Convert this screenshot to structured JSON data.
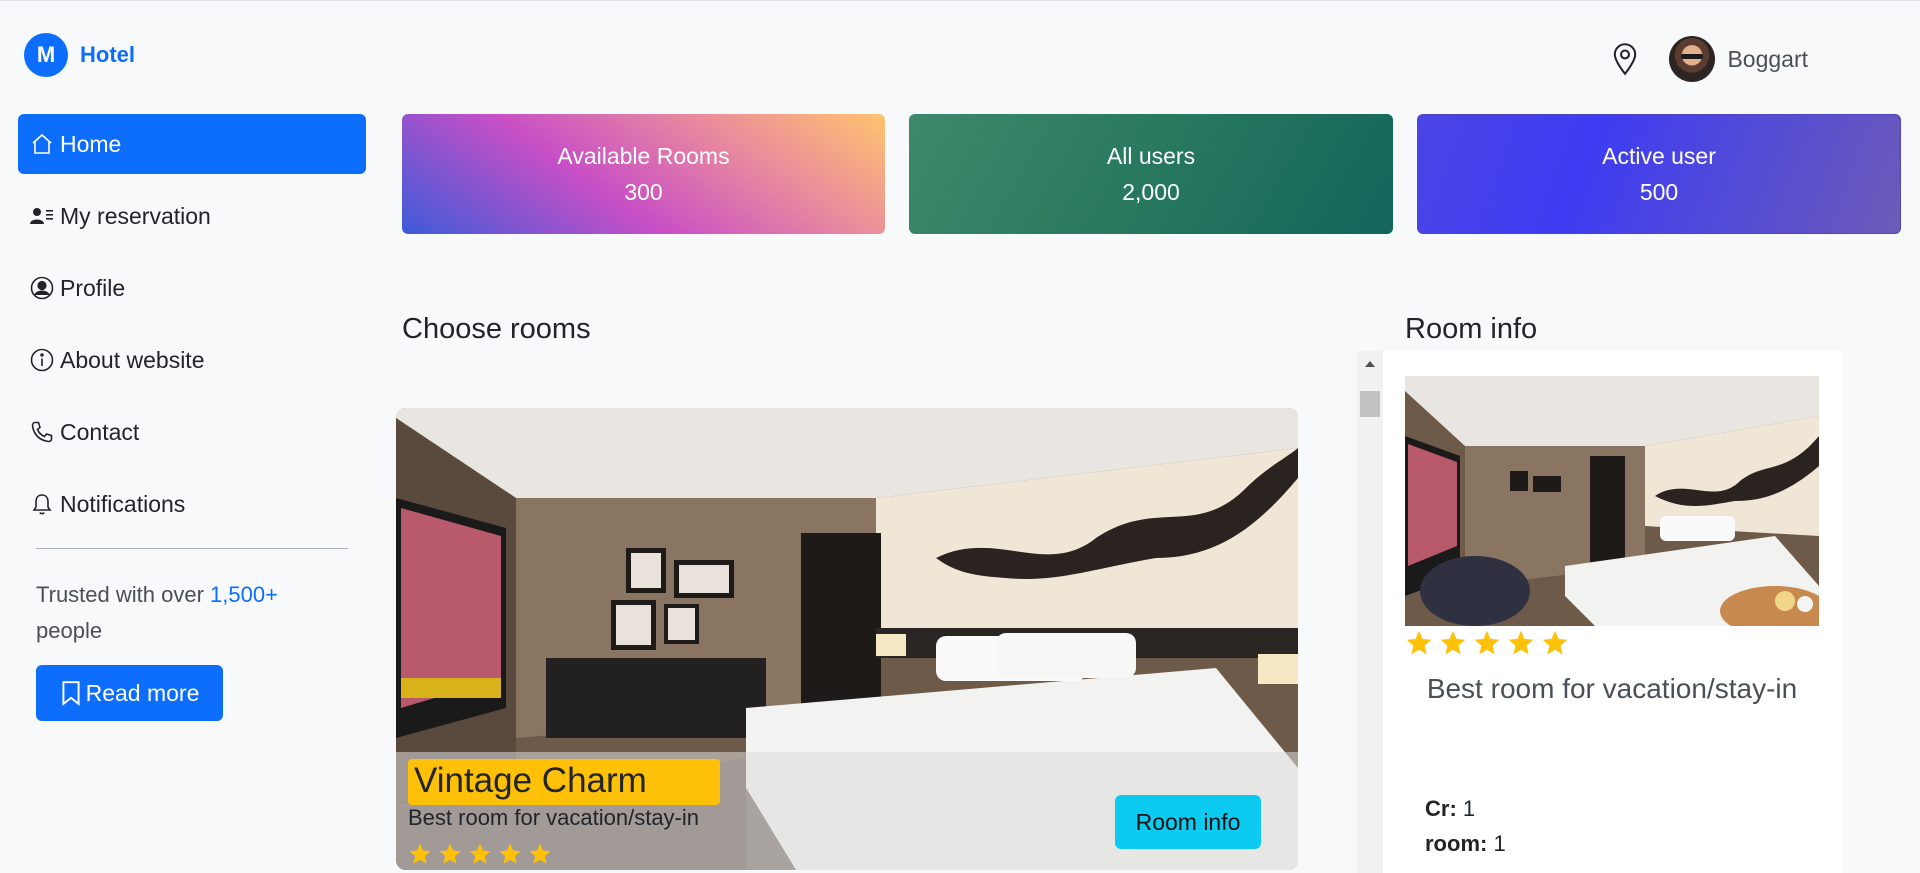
{
  "brand": {
    "logo_letter": "M",
    "name": "Hotel"
  },
  "header": {
    "location_icon": "location-pin-icon",
    "user_name": "Boggart"
  },
  "sidebar": {
    "items": [
      {
        "label": "Home",
        "icon": "house-icon",
        "active": true
      },
      {
        "label": "My reservation",
        "icon": "person-lines-icon",
        "active": false
      },
      {
        "label": "Profile",
        "icon": "person-circle-icon",
        "active": false
      },
      {
        "label": "About website",
        "icon": "info-circle-icon",
        "active": false
      },
      {
        "label": "Contact",
        "icon": "telephone-icon",
        "active": false
      },
      {
        "label": "Notifications",
        "icon": "bell-icon",
        "active": false
      }
    ],
    "trusted_prefix": "Trusted with over",
    "trusted_count": "1,500+",
    "trusted_suffix": "people",
    "read_more_label": "Read more"
  },
  "stats": [
    {
      "label": "Available Rooms",
      "value": "300"
    },
    {
      "label": "All users",
      "value": "2,000"
    },
    {
      "label": "Active user",
      "value": "500"
    }
  ],
  "choose_rooms": {
    "title": "Choose rooms",
    "room": {
      "name": "Vintage Charm",
      "description": "Best room for vacation/stay-in",
      "rating": 5,
      "button_label": "Room info"
    }
  },
  "room_info": {
    "title": "Room info",
    "rating": 5,
    "description": "Best room for vacation/stay-in",
    "cr_label": "Cr:",
    "cr_value": "1",
    "room_label": "room:",
    "room_value": "1"
  },
  "colors": {
    "primary": "#0d6efd",
    "badge": "#ffc107",
    "info_button": "#0dcaf0",
    "star": "#ffc107"
  }
}
